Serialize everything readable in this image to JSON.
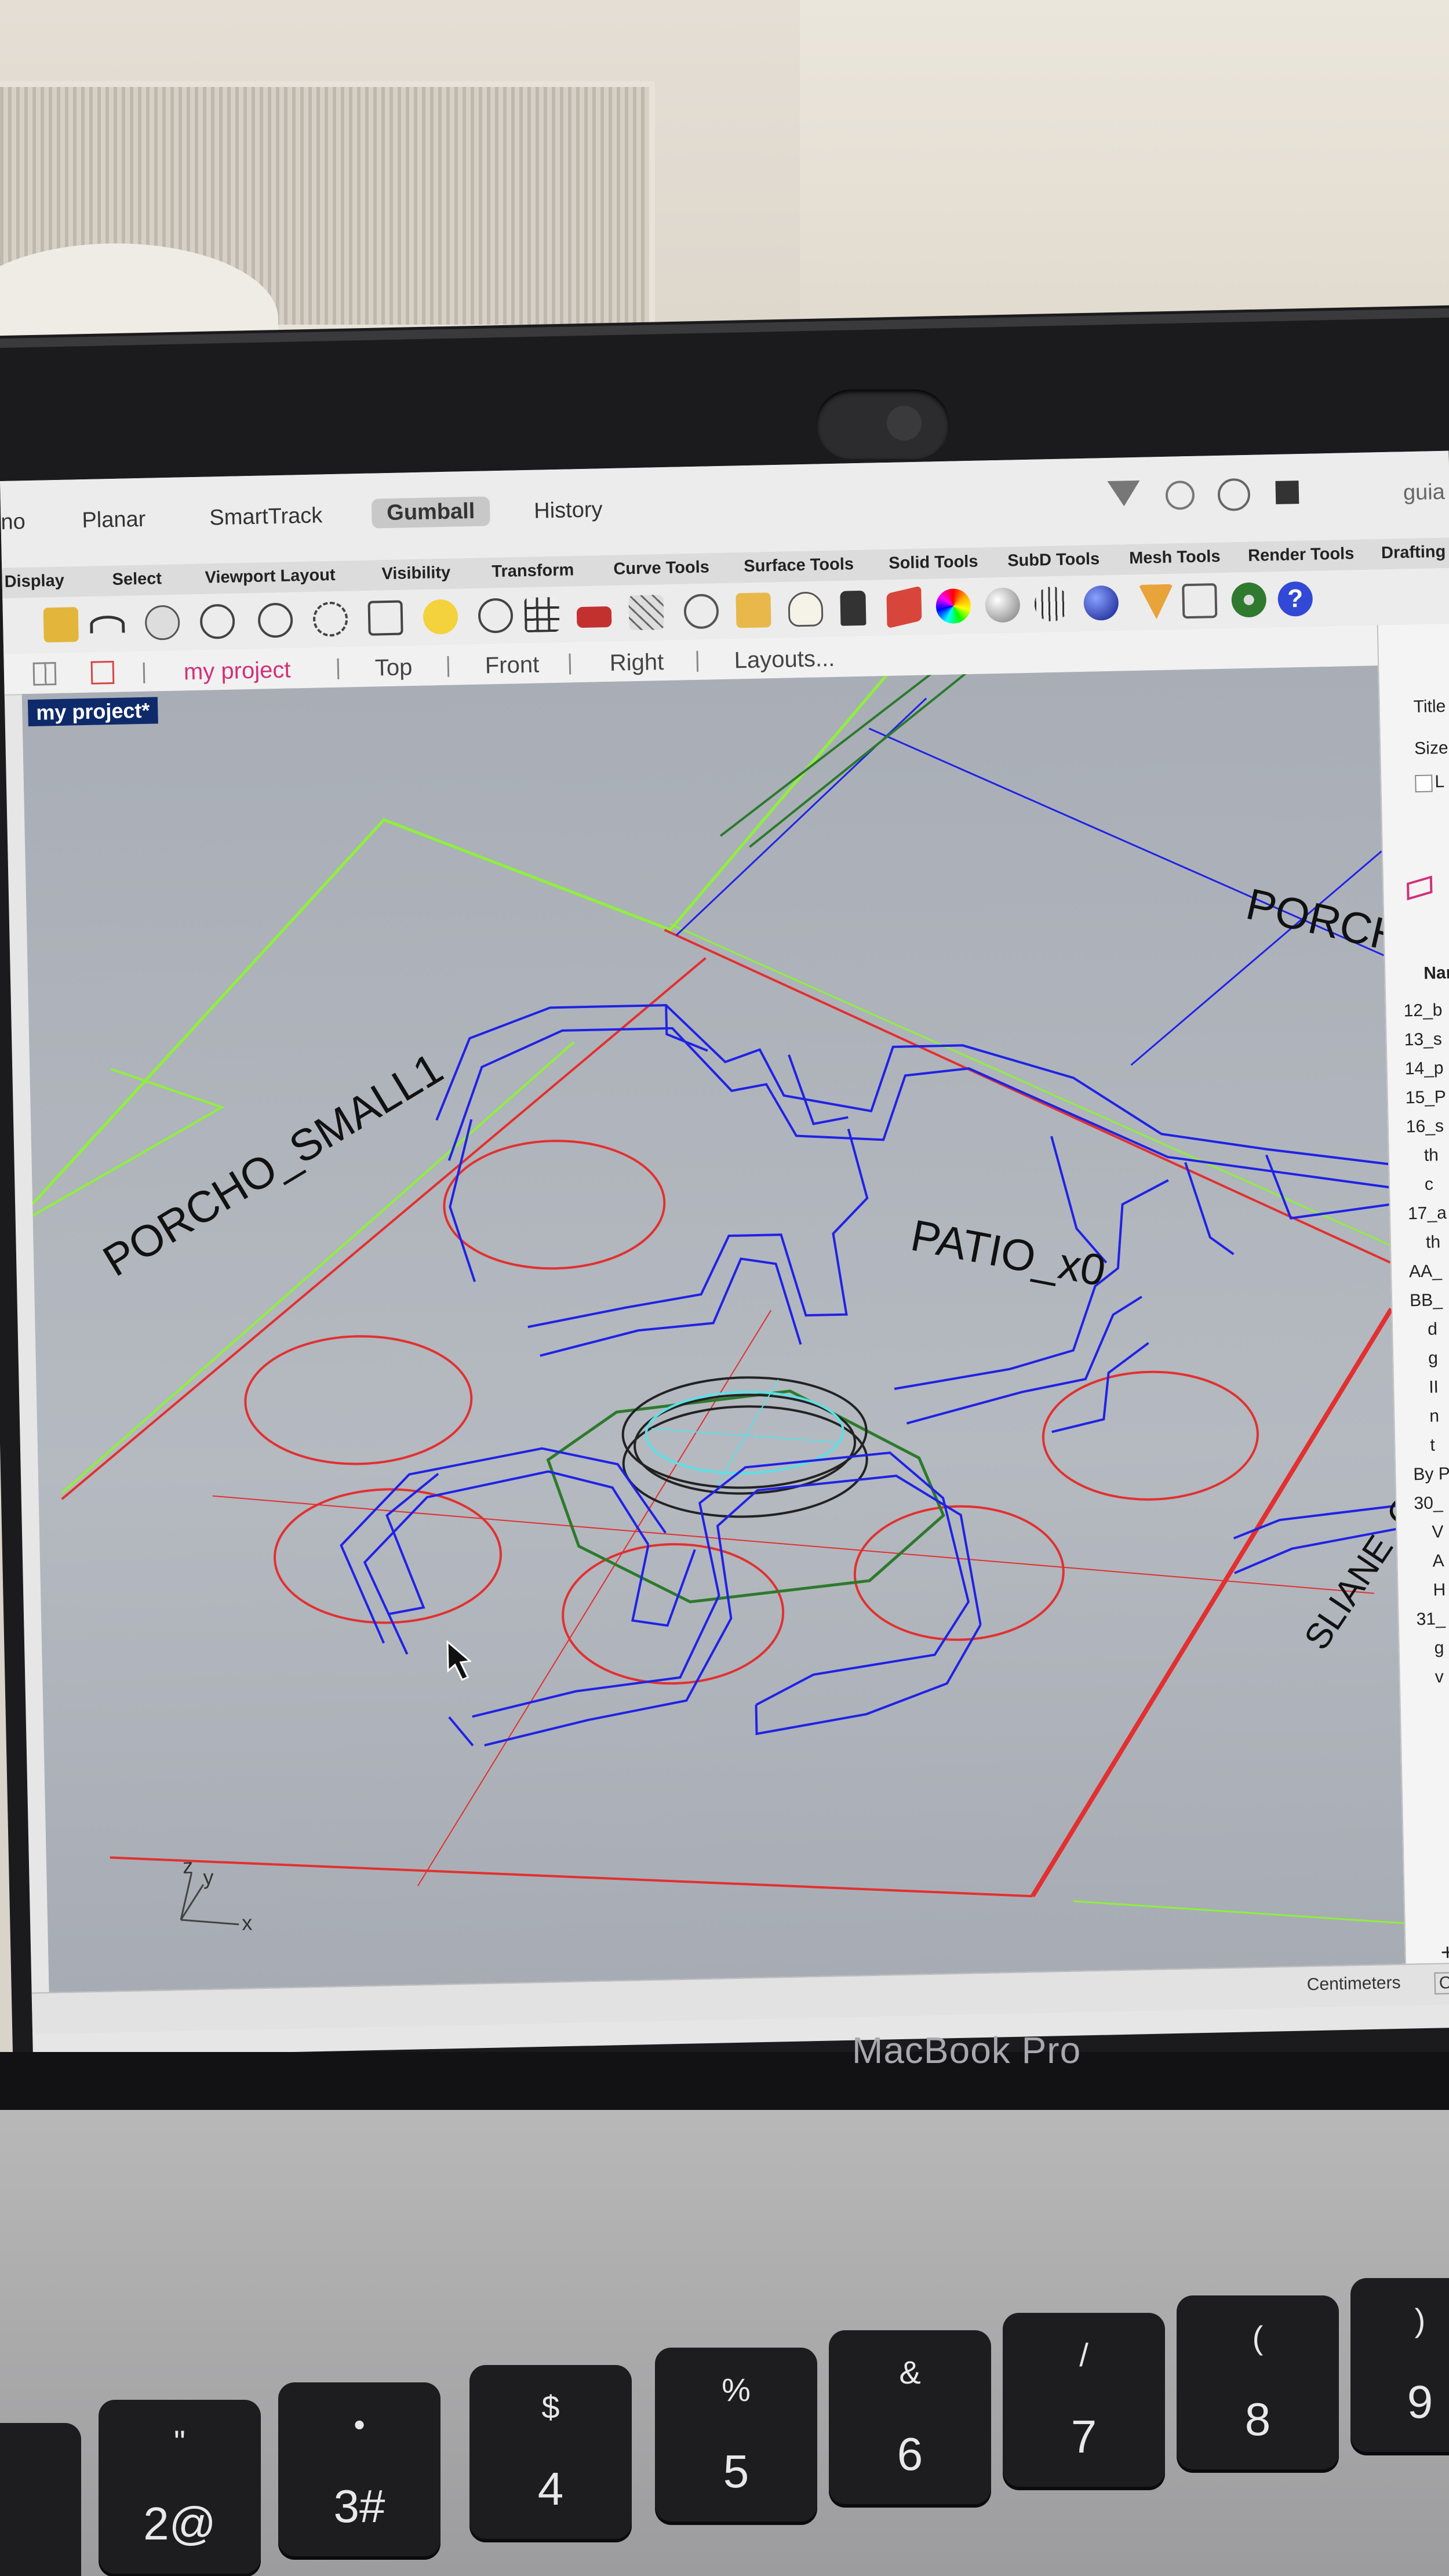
{
  "menubar": {
    "items": [
      "no",
      "Planar",
      "SmartTrack",
      "Gumball",
      "History"
    ],
    "active": "Gumball",
    "right_text": "guia"
  },
  "toolbar_tabs": [
    "Display",
    "Select",
    "Viewport Layout",
    "Visibility",
    "Transform",
    "Curve Tools",
    "Surface Tools",
    "Solid Tools",
    "SubD Tools",
    "Mesh Tools",
    "Render Tools",
    "Drafting"
  ],
  "viewport_tabs": {
    "project": "my project",
    "views": [
      "Top",
      "Front",
      "Right",
      "Layouts..."
    ]
  },
  "viewport": {
    "label": "my project*",
    "annotations": [
      "PORCHO_SMALL1",
      "PATIO_x0",
      "PORCH",
      "SLIANE_OH"
    ],
    "axis": {
      "x": "x",
      "y": "y",
      "z": "z"
    }
  },
  "right_panel": {
    "props": [
      "Title",
      "Size",
      "L"
    ],
    "header": "Nam",
    "layers": [
      "12_b",
      "13_s",
      "14_p",
      "15_P",
      "16_s",
      "th",
      "c",
      "17_a",
      "th",
      "AA_",
      "BB_",
      "d",
      "g",
      "II",
      "n",
      "t",
      "By P",
      "30_",
      "V",
      "A",
      "H",
      "31_",
      "g",
      "v"
    ],
    "add": "+"
  },
  "status": {
    "units": "Centimeters",
    "cplane": "CPlane"
  },
  "laptop": {
    "model": "MacBook Pro"
  },
  "keys": [
    {
      "top": "\"",
      "bot": "2@"
    },
    {
      "top": "•",
      "bot": "3#"
    },
    {
      "top": "$",
      "bot": "4"
    },
    {
      "top": "%",
      "bot": "5"
    },
    {
      "top": "&",
      "bot": "6"
    },
    {
      "top": "/",
      "bot": "7"
    },
    {
      "top": "(",
      "bot": "8"
    },
    {
      "top": ")",
      "bot": "9"
    }
  ],
  "colors": {
    "viewport_bg": "#b0b4bb",
    "structure_blue": "#1f22e6",
    "circle_red": "#e23030",
    "plan_green": "#8ef03c",
    "octagon_green": "#2c7a2c",
    "active_tab": "#d2307a"
  }
}
